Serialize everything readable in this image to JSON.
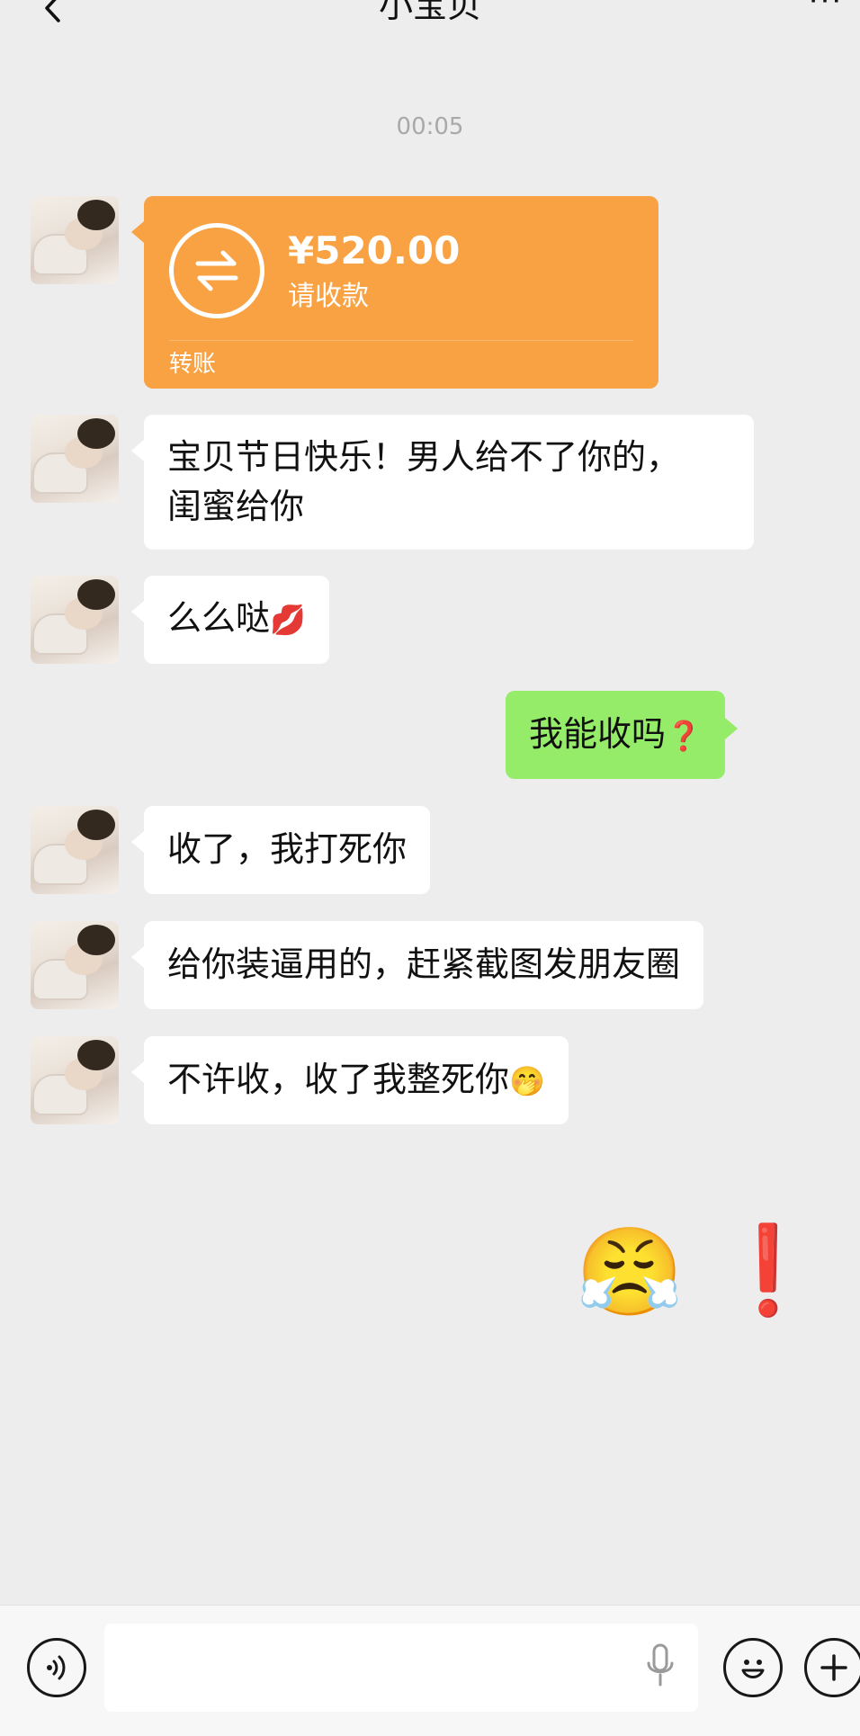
{
  "header": {
    "title": "小宝贝",
    "more_label": "···"
  },
  "timestamp": "00:05",
  "colors": {
    "background": "#ededed",
    "incoming_bubble": "#ffffff",
    "outgoing_bubble": "#95ec69",
    "transfer_card": "#f9a243",
    "exclamation": "#e33b3b"
  },
  "transfer": {
    "amount": "¥520.00",
    "status": "请收款",
    "label": "转账"
  },
  "messages": [
    {
      "sender": "contact",
      "text_line1": "宝贝节日快乐！男人给不了你的，",
      "text_line2": "闺蜜给你"
    },
    {
      "sender": "contact",
      "text": "么么哒",
      "emoji": "💋",
      "emoji_name": "kiss-lips-icon"
    },
    {
      "sender": "me",
      "text": "我能收吗",
      "emoji": "❓",
      "emoji_name": "red-question-mark-icon"
    },
    {
      "sender": "contact",
      "text": "收了，我打死你"
    },
    {
      "sender": "contact",
      "text": "给你装逼用的，赶紧截图发朋友圈"
    },
    {
      "sender": "contact",
      "text": "不许收，收了我整死你",
      "emoji": "🤭",
      "emoji_name": "hand-over-mouth-face-icon"
    }
  ],
  "large_emoji": {
    "face": "😤",
    "face_name": "face-with-steam-icon",
    "mark": "❗",
    "mark_name": "red-exclamation-icon"
  },
  "input": {
    "value": "",
    "placeholder": ""
  },
  "icons": {
    "back": "back-arrow-icon",
    "voice": "voice-mode-icon",
    "mic": "microphone-icon",
    "emoji": "emoji-icon",
    "plus": "plus-icon"
  }
}
